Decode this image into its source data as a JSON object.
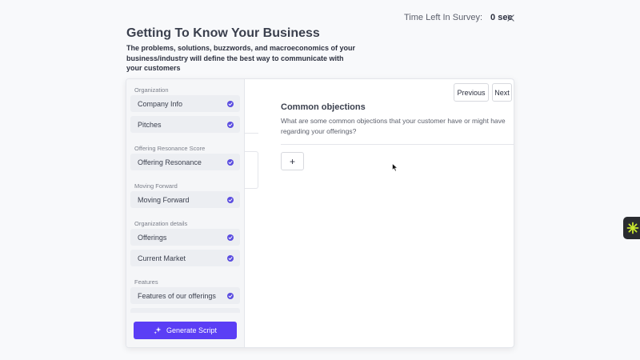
{
  "timer": {
    "label": "Time Left In Survey:",
    "value": "0 sec"
  },
  "page": {
    "title": "Getting To Know Your Business",
    "subtitle": "The problems, solutions, buzzwords, and macroeconomics of your business/industry will define the best way to communicate with your customers"
  },
  "sidebar": {
    "sections": [
      {
        "label": "Organization"
      },
      {
        "label": "Offering Resonance Score"
      },
      {
        "label": "Moving Forward"
      },
      {
        "label": "Organization details"
      },
      {
        "label": "Features"
      }
    ],
    "items": [
      {
        "label": "Company Info",
        "completed": true
      },
      {
        "label": "Pitches",
        "completed": true
      },
      {
        "label": "Offering Resonance",
        "completed": true
      },
      {
        "label": "Moving Forward",
        "completed": true
      },
      {
        "label": "Offerings",
        "completed": true
      },
      {
        "label": "Current Market",
        "completed": true
      },
      {
        "label": "Features of our offerings",
        "completed": true
      }
    ],
    "generate_label": "Generate Script"
  },
  "nav": {
    "previous_label": "Previous",
    "next_label": "Next"
  },
  "question": {
    "title": "Common objections",
    "description": "What are some common objections that your customer have or might have regarding your offerings?",
    "add_label": "+"
  },
  "colors": {
    "accent": "#5b3ef5",
    "check": "#5b4de0",
    "widget_bg": "#2a2c30",
    "widget_icon": "#c8e62e"
  }
}
